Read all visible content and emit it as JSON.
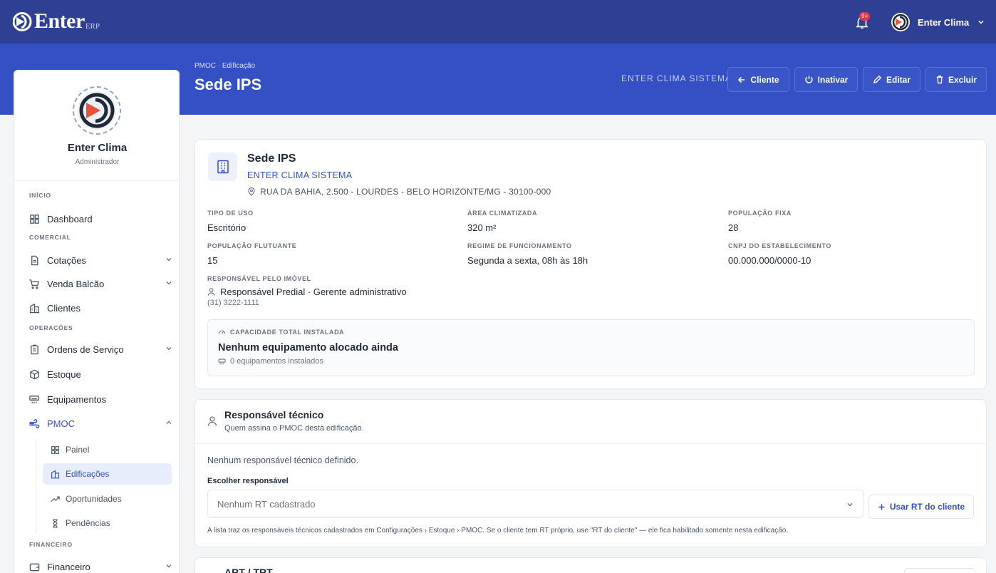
{
  "brand": {
    "name": "Enter",
    "suffix": "ERP"
  },
  "topbar": {
    "badge": "9+",
    "user_name": "Enter Clima"
  },
  "header": {
    "breadcrumb": "PMOC · Edificação",
    "title": "Sede IPS",
    "client_label": "ENTER CLIMA SISTEMA",
    "buttons": {
      "cliente": "Cliente",
      "inativar": "Inativar",
      "editar": "Editar",
      "excluir": "Excluir"
    }
  },
  "sidebar": {
    "user_name": "Enter Clima",
    "user_role": "Administrador",
    "sections": {
      "inicio": "INÍCIO",
      "comercial": "COMERCIAL",
      "operacoes": "OPERAÇÕES",
      "financeiro": "FINANCEIRO"
    },
    "items": {
      "dashboard": "Dashboard",
      "cotacoes": "Cotações",
      "venda_balcao": "Venda Balcão",
      "clientes": "Clientes",
      "ordens": "Ordens de Serviço",
      "estoque": "Estoque",
      "equipamentos": "Equipamentos",
      "pmoc": "PMOC",
      "financeiro": "Financeiro"
    },
    "pmoc_sub": {
      "painel": "Painel",
      "edificacoes": "Edificações",
      "oportunidades": "Oportunidades",
      "pendencias": "Pendências"
    }
  },
  "building": {
    "name": "Sede IPS",
    "client": "ENTER CLIMA SISTEMA",
    "address": "RUA DA BAHIA, 2.500 - LOURDES - BELO HORIZONTE/MG - 30100-000",
    "fields": {
      "tipo_uso": {
        "label": "TIPO DE USO",
        "value": "Escritório"
      },
      "area": {
        "label": "ÁREA CLIMATIZADA",
        "value": "320 m²"
      },
      "pop_fixa": {
        "label": "POPULAÇÃO FIXA",
        "value": "28"
      },
      "pop_flutuante": {
        "label": "POPULAÇÃO FLUTUANTE",
        "value": "15"
      },
      "regime": {
        "label": "REGIME DE FUNCIONAMENTO",
        "value": "Segunda a sexta, 08h às 18h"
      },
      "cnpj": {
        "label": "CNPJ DO ESTABELECIMENTO",
        "value": "00.000.000/0000-10"
      },
      "responsavel": {
        "label": "RESPONSÁVEL PELO IMÓVEL",
        "value": "Responsável Predial · Gerente administrativo",
        "phone": "(31) 3222-1111"
      }
    },
    "capacity": {
      "label": "CAPACIDADE TOTAL INSTALADA",
      "value": "Nenhum equipamento alocado ainda",
      "count": "0 equipamentos instalados"
    }
  },
  "rt": {
    "title": "Responsável técnico",
    "subtitle": "Quem assina o PMOC desta edificação.",
    "empty": "Nenhum responsável técnico definido.",
    "choose_label": "Escolher responsável",
    "select_value": "Nenhum RT cadastrado",
    "button": "Usar RT do cliente",
    "help": "A lista traz os responsáveis técnicos cadastrados em Configurações › Estoque › PMOC. Se o cliente tem RT próprio, use \"RT do cliente\" — ele fica habilitado somente nesta edificação."
  },
  "art": {
    "title": "ART / TRT"
  },
  "colors": {
    "primary": "#3550c4",
    "topbar": "#2f3f93",
    "badge": "#e8334a"
  }
}
